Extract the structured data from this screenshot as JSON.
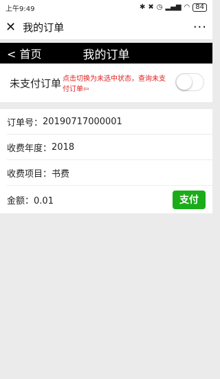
{
  "status_bar": {
    "time": "上午9:49",
    "battery": "84"
  },
  "wechat_header": {
    "title": "我的订单"
  },
  "navbar": {
    "back_label": "< 首页",
    "title": "我的订单"
  },
  "filter": {
    "label": "未支付订单",
    "hint": "点击切换为未选中状态，查询未支付订单",
    "arrow": "⇦",
    "toggle_on": false
  },
  "order": {
    "number_label": "订单号",
    "number_value": "20190717000001",
    "year_label": "收费年度",
    "year_value": "2018",
    "item_label": "收费项目",
    "item_value": "书费",
    "amount_label": "金额",
    "amount_value": "0.01",
    "pay_label": "支付"
  },
  "colors": {
    "pay_button": "#1aad19",
    "hint_text": "#e02020",
    "navbar_bg": "#000000"
  }
}
